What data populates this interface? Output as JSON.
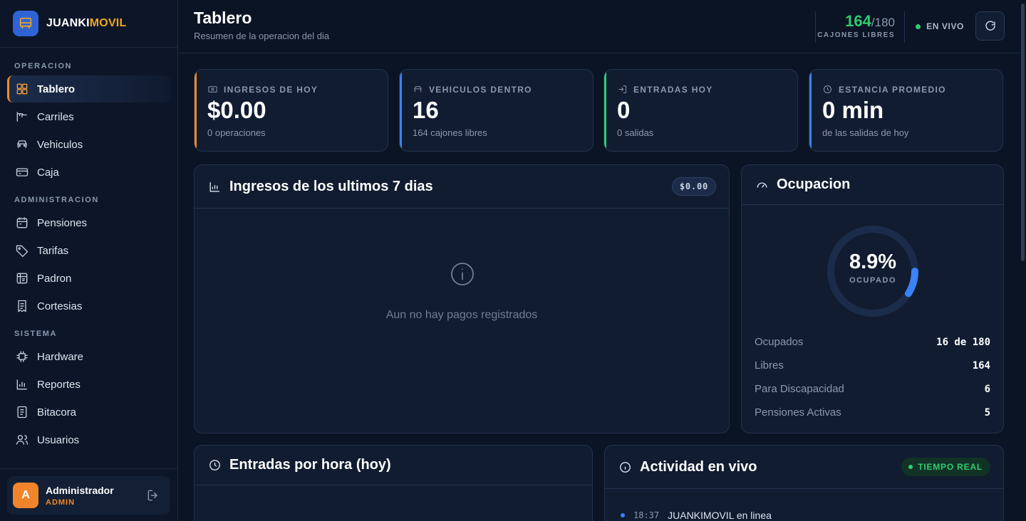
{
  "brand": {
    "name_part1": "JUANKI",
    "name_part2": "MOVIL"
  },
  "sidebar": {
    "sections": [
      {
        "title": "OPERACION",
        "items": [
          {
            "label": "Tablero",
            "icon": "dashboard-icon",
            "active": true
          },
          {
            "label": "Carriles",
            "icon": "lane-icon"
          },
          {
            "label": "Vehiculos",
            "icon": "car-icon"
          },
          {
            "label": "Caja",
            "icon": "cash-register-icon"
          }
        ]
      },
      {
        "title": "ADMINISTRACION",
        "items": [
          {
            "label": "Pensiones",
            "icon": "calendar-icon"
          },
          {
            "label": "Tarifas",
            "icon": "tag-icon"
          },
          {
            "label": "Padron",
            "icon": "id-card-icon"
          },
          {
            "label": "Cortesias",
            "icon": "receipt-icon"
          }
        ]
      },
      {
        "title": "SISTEMA",
        "items": [
          {
            "label": "Hardware",
            "icon": "chip-icon"
          },
          {
            "label": "Reportes",
            "icon": "bar-chart-icon"
          },
          {
            "label": "Bitacora",
            "icon": "log-icon"
          },
          {
            "label": "Usuarios",
            "icon": "users-icon"
          }
        ]
      }
    ],
    "user": {
      "initial": "A",
      "name": "Administrador",
      "role": "ADMIN"
    }
  },
  "header": {
    "title": "Tablero",
    "subtitle": "Resumen de la operacion del dia",
    "capacity_free": "164",
    "capacity_total": "/180",
    "capacity_label": "CAJONES LIBRES",
    "live_label": "EN VIVO"
  },
  "stats": [
    {
      "label": "INGRESOS DE HOY",
      "value": "$0.00",
      "note": "0 operaciones",
      "icon": "cash-icon",
      "accent": "#f08a24"
    },
    {
      "label": "VEHICULOS DENTRO",
      "value": "16",
      "note": "164 cajones libres",
      "icon": "car-icon",
      "accent": "#3b82f6"
    },
    {
      "label": "ENTRADAS HOY",
      "value": "0",
      "note": "0 salidas",
      "icon": "login-icon",
      "accent": "#2ecc71"
    },
    {
      "label": "ESTANCIA PROMEDIO",
      "value": "0 min",
      "note": "de las salidas de hoy",
      "icon": "clock-icon",
      "accent": "#3b82f6"
    }
  ],
  "revenue_panel": {
    "title": "Ingresos de los ultimos 7 dias",
    "total": "$0.00",
    "empty_text": "Aun no hay pagos registrados"
  },
  "occupancy": {
    "title": "Ocupacion",
    "percent": "8.9%",
    "percent_value": 0.089,
    "percent_label": "OCUPADO",
    "rows": [
      {
        "label": "Ocupados",
        "value": "16 de 180"
      },
      {
        "label": "Libres",
        "value": "164"
      },
      {
        "label": "Para Discapacidad",
        "value": "6"
      },
      {
        "label": "Pensiones Activas",
        "value": "5"
      }
    ]
  },
  "hourly_panel": {
    "title": "Entradas por hora (hoy)"
  },
  "activity": {
    "title": "Actividad en vivo",
    "badge": "TIEMPO REAL",
    "items": [
      {
        "time": "18:37",
        "text": "JUANKIMOVIL en linea"
      }
    ]
  },
  "colors": {
    "accent_orange": "#f08a24",
    "accent_green": "#2ecc71",
    "accent_blue": "#3b82f6",
    "background": "#0b1424"
  }
}
